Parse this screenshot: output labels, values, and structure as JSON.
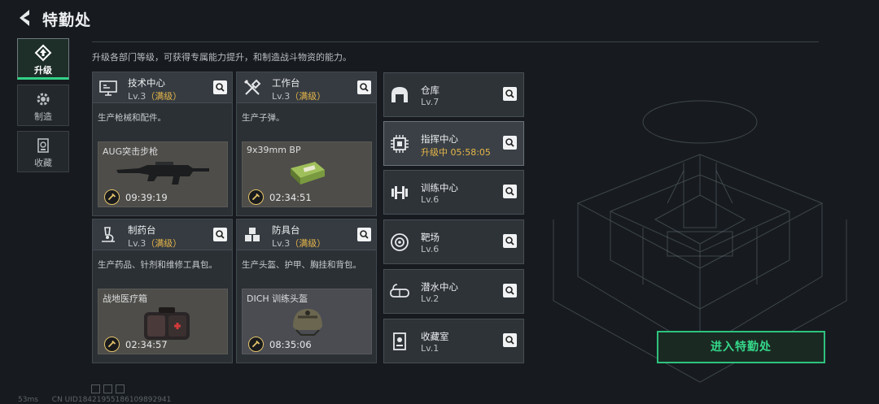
{
  "header": {
    "title": "特勤处"
  },
  "description": "升级各部门等级，可获得专属能力提升，和制造战斗物资的能力。",
  "left_nav": [
    {
      "label": "升级",
      "icon": "upgrade-icon",
      "active": true
    },
    {
      "label": "制造",
      "icon": "gear-icon",
      "active": false
    },
    {
      "label": "收藏",
      "icon": "collection-icon",
      "active": false
    }
  ],
  "cards": [
    {
      "name": "技术中心",
      "level": "Lv.3",
      "max": "（满级）",
      "desc": "生产枪械和配件。",
      "product": "AUG突击步枪",
      "time": "09:39:19",
      "icon": "monitor-icon"
    },
    {
      "name": "工作台",
      "level": "Lv.3",
      "max": "（满级）",
      "desc": "生产子弹。",
      "product": "9x39mm BP",
      "time": "02:34:51",
      "icon": "tools-icon"
    },
    {
      "name": "制药台",
      "level": "Lv.3",
      "max": "（满级）",
      "desc": "生产药品、针剂和维修工具包。",
      "product": "战地医疗箱",
      "time": "02:34:57",
      "icon": "microscope-icon"
    },
    {
      "name": "防具台",
      "level": "Lv.3",
      "max": "（满级）",
      "desc": "生产头盔、护甲、胸挂和背包。",
      "product": "DICH 训练头盔",
      "time": "08:35:06",
      "icon": "cubes-icon"
    }
  ],
  "facilities": [
    {
      "name": "仓库",
      "level": "Lv.7",
      "icon": "warehouse-icon"
    },
    {
      "name": "指挥中心",
      "level": "升级中 05:58:05",
      "icon": "chip-icon",
      "upgrading": true
    },
    {
      "name": "训练中心",
      "level": "Lv.6",
      "icon": "dumbbell-icon"
    },
    {
      "name": "靶场",
      "level": "Lv.6",
      "icon": "target-icon"
    },
    {
      "name": "潜水中心",
      "level": "Lv.2",
      "icon": "goggles-icon"
    },
    {
      "name": "收藏室",
      "level": "Lv.1",
      "icon": "display-case-icon"
    }
  ],
  "enter_button": "进入特勤处",
  "status": {
    "ping": "53ms",
    "uid": "CN UID18421955186109892941"
  },
  "colors": {
    "accent": "#2ec27e",
    "gold": "#e7b64a",
    "bg": "#171b1f"
  }
}
